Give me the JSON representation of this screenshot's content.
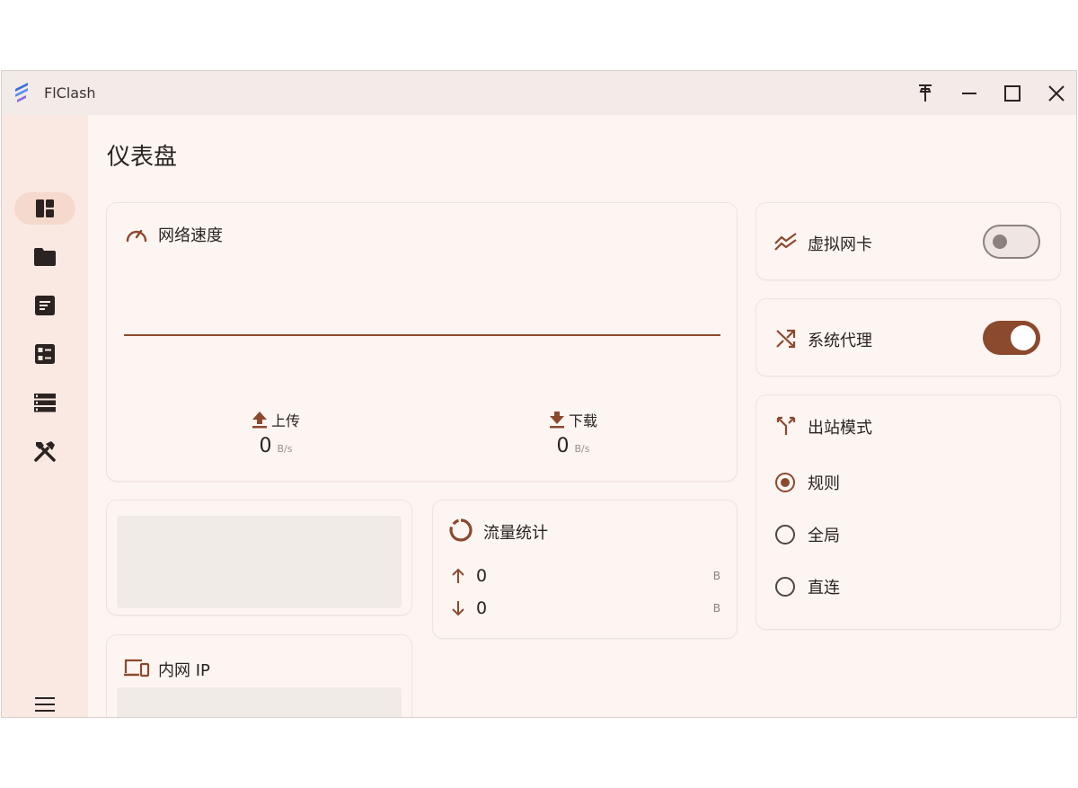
{
  "app": {
    "title": "FlClash"
  },
  "window_controls": {
    "pin": "pin-icon",
    "minimize": "minimize-icon",
    "maximize": "maximize-icon",
    "close": "close-icon"
  },
  "sidebar": {
    "items": [
      {
        "icon": "dashboard-icon",
        "active": true
      },
      {
        "icon": "folder-icon",
        "active": false
      },
      {
        "icon": "notes-icon",
        "active": false
      },
      {
        "icon": "grid-list-icon",
        "active": false
      },
      {
        "icon": "list-icon",
        "active": false
      },
      {
        "icon": "tools-icon",
        "active": false
      }
    ],
    "menu_icon": "menu-icon"
  },
  "page": {
    "title": "仪表盘"
  },
  "network_speed": {
    "title": "网络速度",
    "upload": {
      "label": "上传",
      "value": "0",
      "unit": "B/s"
    },
    "download": {
      "label": "下载",
      "value": "0",
      "unit": "B/s"
    }
  },
  "traffic": {
    "title": "流量统计",
    "up": {
      "value": "0",
      "unit": "B"
    },
    "down": {
      "value": "0",
      "unit": "B"
    }
  },
  "intranet_ip": {
    "title": "内网 IP"
  },
  "tun": {
    "title": "虚拟网卡",
    "enabled": false
  },
  "system_proxy": {
    "title": "系统代理",
    "enabled": true
  },
  "outbound_mode": {
    "title": "出站模式",
    "options": [
      {
        "label": "规则",
        "selected": true
      },
      {
        "label": "全局",
        "selected": false
      },
      {
        "label": "直连",
        "selected": false
      }
    ]
  },
  "colors": {
    "accent": "#8b4a2d",
    "background": "#fdf5f2",
    "sidebar": "#fae9e3",
    "titlebar": "#f3ebe8"
  }
}
